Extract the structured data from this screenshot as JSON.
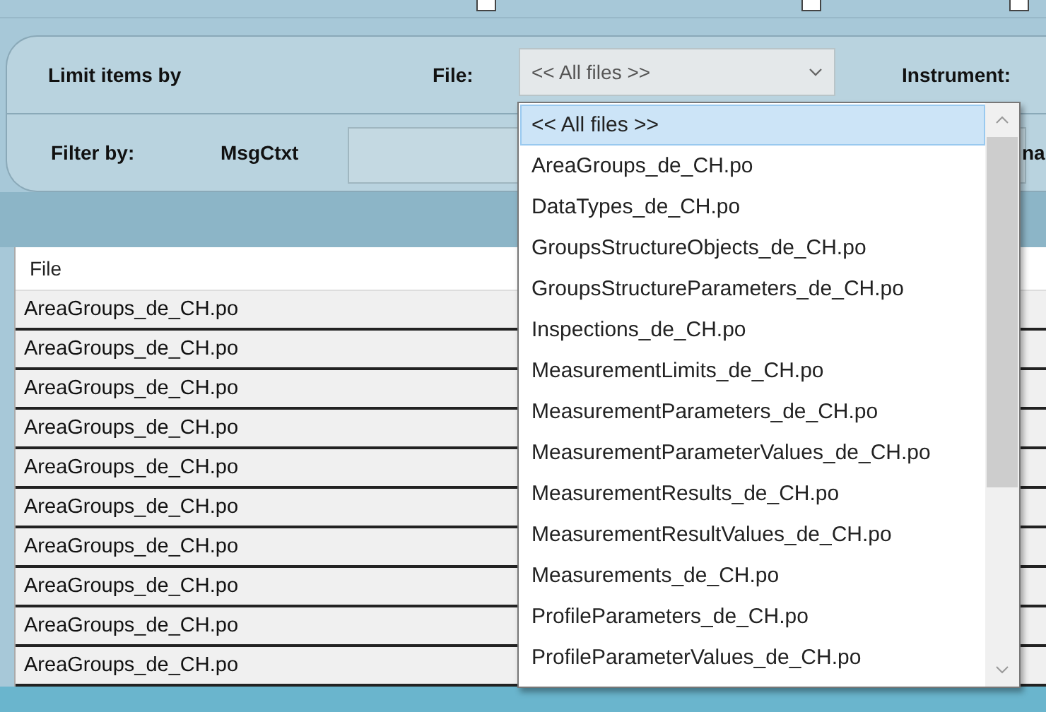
{
  "top_checkboxes": [
    {
      "checked": false
    },
    {
      "checked": false
    },
    {
      "checked": false
    }
  ],
  "limit_bar": {
    "title": "Limit items by",
    "file_label": "File:",
    "file_value": "<< All files >>",
    "instrument_label": "Instrument:"
  },
  "filter_bar": {
    "title": "Filter by:",
    "msgctxt_label": "MsgCtxt",
    "cut_label": "na"
  },
  "table": {
    "columns": [
      "File"
    ],
    "rows": [
      "AreaGroups_de_CH.po",
      "AreaGroups_de_CH.po",
      "AreaGroups_de_CH.po",
      "AreaGroups_de_CH.po",
      "AreaGroups_de_CH.po",
      "AreaGroups_de_CH.po",
      "AreaGroups_de_CH.po",
      "AreaGroups_de_CH.po",
      "AreaGroups_de_CH.po",
      "AreaGroups_de_CH.po"
    ]
  },
  "dropdown": {
    "options": [
      {
        "label": "<< All files >>",
        "selected": true
      },
      {
        "label": "AreaGroups_de_CH.po",
        "selected": false
      },
      {
        "label": "DataTypes_de_CH.po",
        "selected": false
      },
      {
        "label": "GroupsStructureObjects_de_CH.po",
        "selected": false
      },
      {
        "label": "GroupsStructureParameters_de_CH.po",
        "selected": false
      },
      {
        "label": "Inspections_de_CH.po",
        "selected": false
      },
      {
        "label": "MeasurementLimits_de_CH.po",
        "selected": false
      },
      {
        "label": "MeasurementParameters_de_CH.po",
        "selected": false
      },
      {
        "label": "MeasurementParameterValues_de_CH.po",
        "selected": false
      },
      {
        "label": "MeasurementResults_de_CH.po",
        "selected": false
      },
      {
        "label": "MeasurementResultValues_de_CH.po",
        "selected": false
      },
      {
        "label": "Measurements_de_CH.po",
        "selected": false
      },
      {
        "label": "ProfileParameters_de_CH.po",
        "selected": false
      },
      {
        "label": "ProfileParameterValues_de_CH.po",
        "selected": false
      }
    ]
  }
}
